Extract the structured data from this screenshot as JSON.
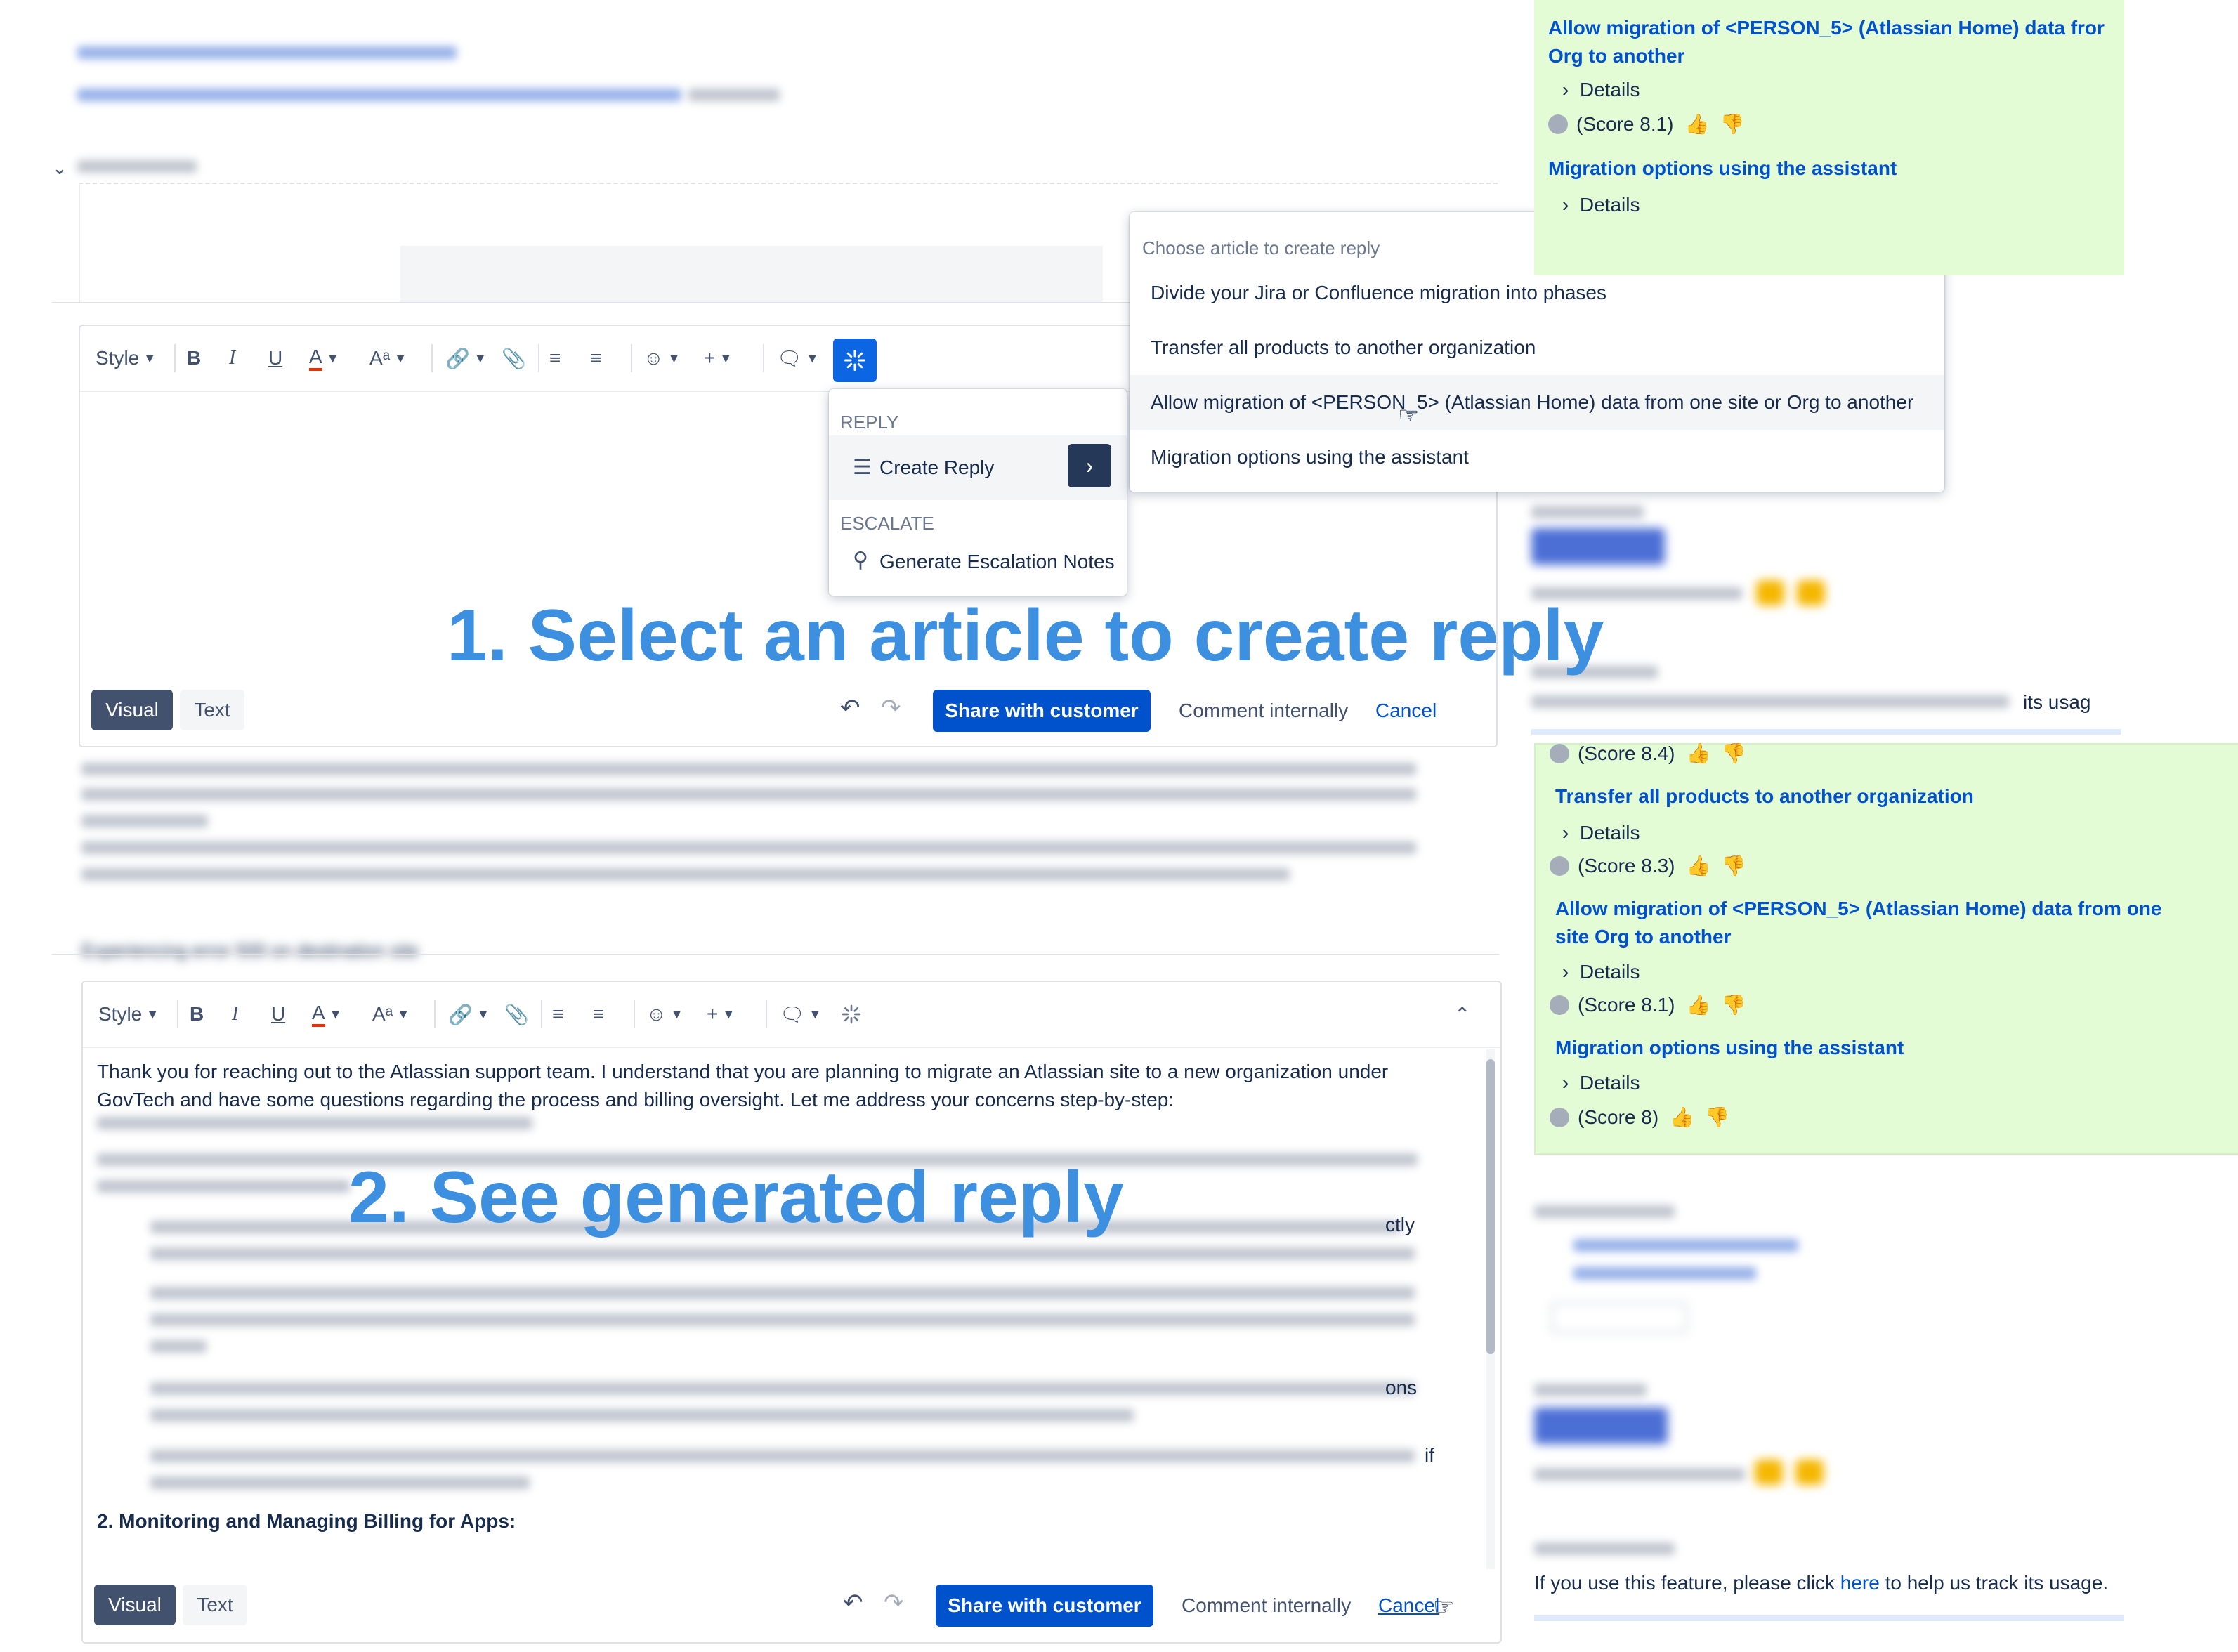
{
  "editor": {
    "style_label": "Style",
    "visual_label": "Visual",
    "text_label": "Text",
    "share_label": "Share with customer",
    "comment_label": "Comment internally",
    "cancel_label": "Cancel"
  },
  "ai_menu": {
    "reply_header": "REPLY",
    "create_reply": "Create Reply",
    "escalate_header": "ESCALATE",
    "generate_escalation": "Generate Escalation Notes"
  },
  "article_menu": {
    "header": "Choose article to create reply",
    "items": [
      "Divide your Jira or Confluence migration into phases",
      "Transfer all products to another organization",
      "Allow migration of <PERSON_5> (Atlassian Home) data from one site or Org to another",
      "Migration options using the assistant"
    ]
  },
  "overlay": {
    "step1": "1. Select an article to create reply",
    "step2": "2. See generated reply"
  },
  "reply": {
    "intro": "Thank you for reaching out to the Atlassian support team. I understand that you are planning to migrate an Atlassian site to a new organization under GovTech and have some questions regarding the process and billing oversight. Let me address your concerns step-by-step:",
    "frag1": "ctly",
    "frag2": "ons",
    "frag3": "if",
    "section2": "2. Monitoring and Managing Billing for Apps:"
  },
  "blur_fragments": {
    "left_heading": "Experiencing error 500 on destination site",
    "right_usage": "its usag"
  },
  "right_panel_top": {
    "article_title": "Allow migration of <PERSON_5> (Atlassian Home) data fror Org to another",
    "details": "Details",
    "score": "(Score 8.1)",
    "article2": "Migration options using the assistant",
    "details2": "Details"
  },
  "right_panel_bottom": {
    "score1": "(Score 8.4)",
    "article1": "Transfer all products to another organization",
    "details1": "Details",
    "score2": "(Score 8.3)",
    "article2": "Allow migration of <PERSON_5> (Atlassian Home) data from one site Org to another",
    "details2": "Details",
    "score3": "(Score 8.1)",
    "article3": "Migration options using the assistant",
    "details3": "Details",
    "score4": "(Score 8)"
  },
  "usage_note": {
    "before": "If you use this feature, please click ",
    "link": "here",
    "after": " to help us track its usage."
  },
  "colors": {
    "primary": "#0052cc",
    "ai_button": "#0c66e4",
    "green_panel": "#e3fcd6",
    "overlay_text": "#3d8fe0",
    "visual_button": "#42526e"
  }
}
